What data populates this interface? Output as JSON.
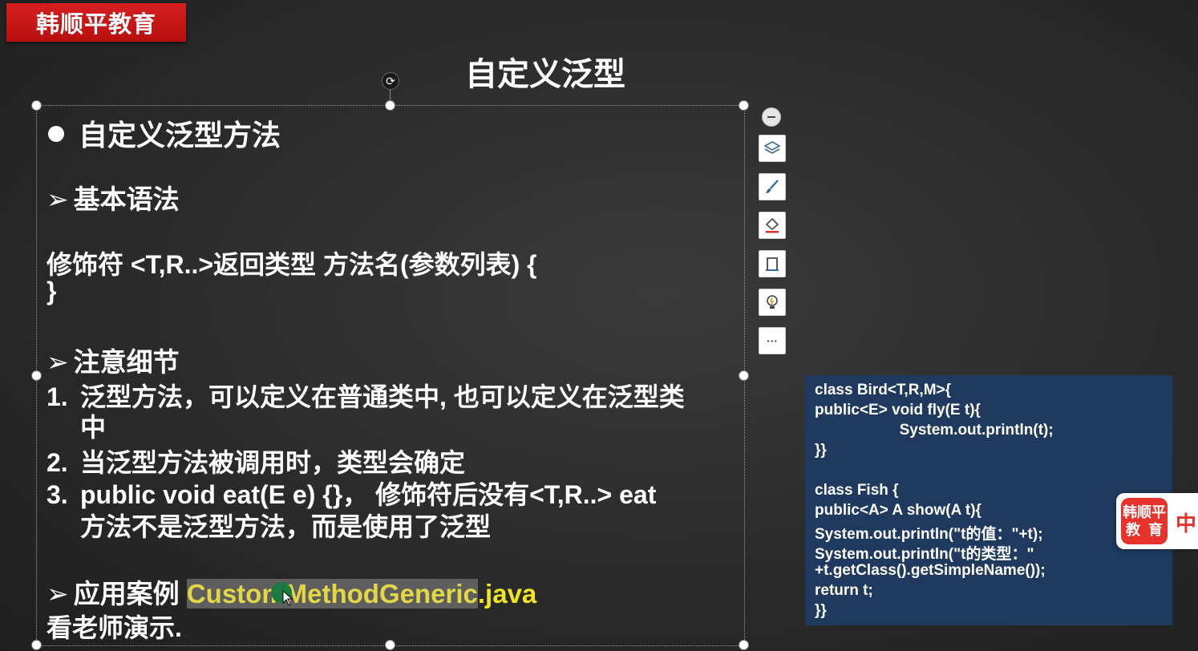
{
  "brand": {
    "tag": "韩顺平教育"
  },
  "slide": {
    "title": "自定义泛型",
    "heading": "自定义泛型方法",
    "syntax_label": "基本语法",
    "syntax_line1": "修饰符 <T,R..>返回类型 方法名(参数列表) {",
    "syntax_line2": "}",
    "notes_label": "注意细节",
    "notes": [
      {
        "num": "1.",
        "line1": "泛型方法，可以定义在普通类中, 也可以定义在泛型类",
        "line2": "中"
      },
      {
        "num": "2.",
        "line1": "当泛型方法被调用时，类型会确定"
      },
      {
        "num": "3.",
        "line1": "public void eat(E e) {}， 修饰符后没有<T,R..> eat",
        "line2": "方法不是泛型方法，而是使用了泛型"
      }
    ],
    "case_label": "应用案例",
    "case_file_highlight": "CustomMethodGeneric",
    "case_file_ext": ".java",
    "case_note": "看老师演示."
  },
  "toolbar": {
    "items": [
      {
        "icon": "layers-icon"
      },
      {
        "icon": "brush-icon"
      },
      {
        "icon": "fill-icon"
      },
      {
        "icon": "frame-icon"
      },
      {
        "icon": "lightbulb-icon"
      },
      {
        "icon": "more-icon",
        "label": "···"
      }
    ]
  },
  "code_panel": {
    "lines": [
      "class Bird<T,R,M>{",
      "public<E> void fly(E t){",
      "                    System.out.println(t);",
      "}}",
      "",
      "class Fish {",
      "public<A> A show(A t){",
      "System.out.println(\"t的值：\"+t);",
      "System.out.println(\"t的类型：\"",
      "+t.getClass().getSimpleName());",
      "return t;",
      "}}"
    ]
  },
  "logo_widget": {
    "line1": "韩顺平",
    "line2": "教  育",
    "extra": "中"
  },
  "colors": {
    "brand_red": "#c8171a",
    "code_bg": "#1f3a5e",
    "highlight_text": "#e2d845",
    "java_yellow": "#f0e51f"
  }
}
